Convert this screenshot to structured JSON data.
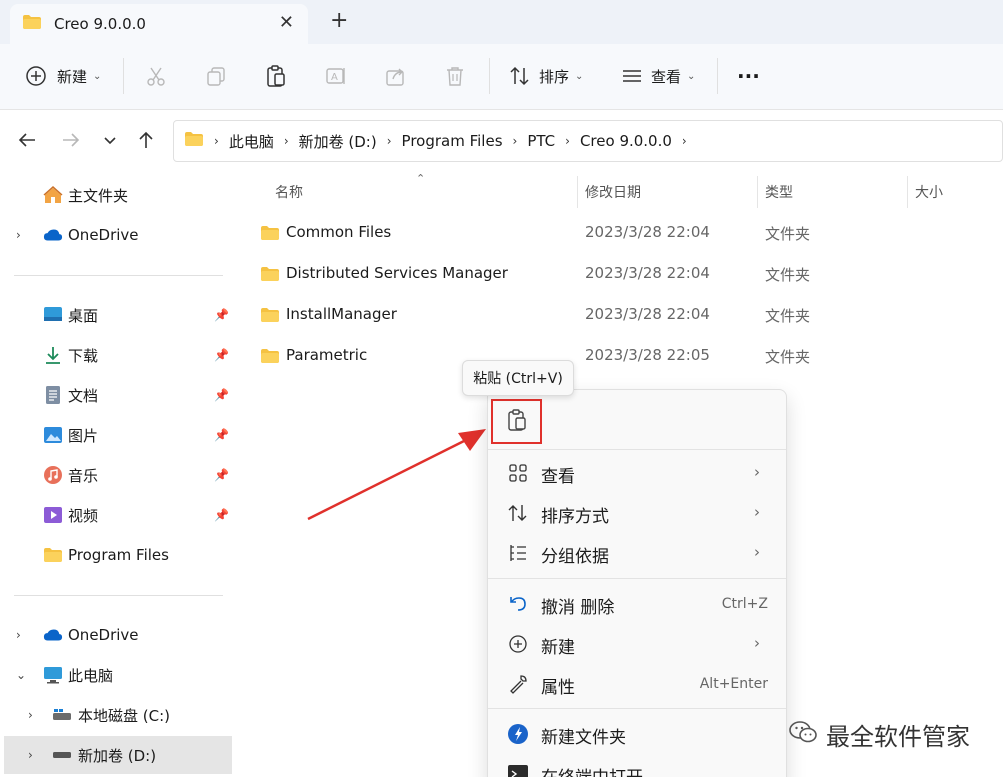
{
  "tab": {
    "title": "Creo 9.0.0.0",
    "close": "✕",
    "new_tab": "+"
  },
  "toolbar": {
    "new_label": "新建",
    "sort_label": "排序",
    "view_label": "查看",
    "more_label": "···"
  },
  "address": {
    "crumbs": [
      "此电脑",
      "新加卷 (D:)",
      "Program Files",
      "PTC",
      "Creo 9.0.0.0"
    ],
    "sep": "›"
  },
  "sidebar": {
    "items": [
      {
        "label": "主文件夹",
        "icon": "home-icon"
      },
      {
        "label": "OneDrive",
        "icon": "cloud-icon"
      },
      {
        "label": "桌面",
        "icon": "desktop-icon"
      },
      {
        "label": "下载",
        "icon": "download-icon"
      },
      {
        "label": "文档",
        "icon": "document-icon"
      },
      {
        "label": "图片",
        "icon": "picture-icon"
      },
      {
        "label": "音乐",
        "icon": "music-icon"
      },
      {
        "label": "视频",
        "icon": "video-icon"
      },
      {
        "label": "Program Files",
        "icon": "folder-icon"
      },
      {
        "label": "OneDrive",
        "icon": "cloud-icon"
      },
      {
        "label": "此电脑",
        "icon": "computer-icon"
      },
      {
        "label": "本地磁盘 (C:)",
        "icon": "drive-icon"
      },
      {
        "label": "新加卷 (D:)",
        "icon": "drive-icon"
      }
    ]
  },
  "columns": {
    "name": "名称",
    "date": "修改日期",
    "type": "类型",
    "size": "大小"
  },
  "files": [
    {
      "name": "Common Files",
      "date": "2023/3/28 22:04",
      "type": "文件夹"
    },
    {
      "name": "Distributed Services Manager",
      "date": "2023/3/28 22:04",
      "type": "文件夹"
    },
    {
      "name": "InstallManager",
      "date": "2023/3/28 22:04",
      "type": "文件夹"
    },
    {
      "name": "Parametric",
      "date": "2023/3/28 22:05",
      "type": "文件夹"
    }
  ],
  "tooltip": {
    "text": "粘贴 (Ctrl+V)"
  },
  "context_menu": {
    "view": "查看",
    "sort": "排序方式",
    "group": "分组依据",
    "undo": "撤消 删除",
    "undo_key": "Ctrl+Z",
    "new": "新建",
    "properties": "属性",
    "properties_key": "Alt+Enter",
    "new_folder": "新建文件夹",
    "open_terminal": "在终端中打开"
  },
  "watermark": {
    "text": "最全软件管家"
  },
  "colors": {
    "accent": "#0067c0",
    "highlight": "#e0312c",
    "folder": "#f5c242"
  }
}
